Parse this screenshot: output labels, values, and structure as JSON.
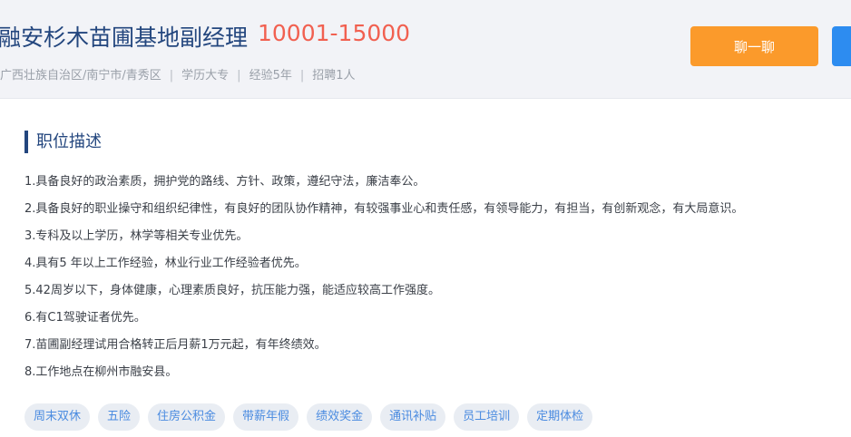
{
  "header": {
    "title": "融安杉木苗圃基地副经理",
    "salary": "10001-15000",
    "location": "广西壮族自治区/南宁市/青秀区",
    "education": "学历大专",
    "experience": "经验5年",
    "headcount": "招聘1人",
    "separator": "|",
    "chat_label": "聊一聊"
  },
  "section": {
    "title": "职位描述"
  },
  "description": [
    "1.具备良好的政治素质，拥护党的路线、方针、政策，遵纪守法，廉洁奉公。",
    "2.具备良好的职业操守和组织纪律性，有良好的团队协作精神，有较强事业心和责任感，有领导能力，有担当，有创新观念，有大局意识。",
    "3.专科及以上学历，林学等相关专业优先。",
    "4.具有5 年以上工作经验，林业行业工作经验者优先。",
    "5.42周岁以下，身体健康，心理素质良好，抗压能力强，能适应较高工作强度。",
    "6.有C1驾驶证者优先。",
    "7.苗圃副经理试用合格转正后月薪1万元起，有年终绩效。",
    "8.工作地点在柳州市融安县。"
  ],
  "tags": [
    "周末双休",
    "五险",
    "住房公积金",
    "带薪年假",
    "绩效奖金",
    "通讯补贴",
    "员工培训",
    "定期体检"
  ],
  "colors": {
    "brand": "#23467e",
    "salary": "#f16050",
    "chat_button": "#fb9a2b",
    "apply_button": "#2d8cf0",
    "tag_text": "#4a8be0"
  }
}
